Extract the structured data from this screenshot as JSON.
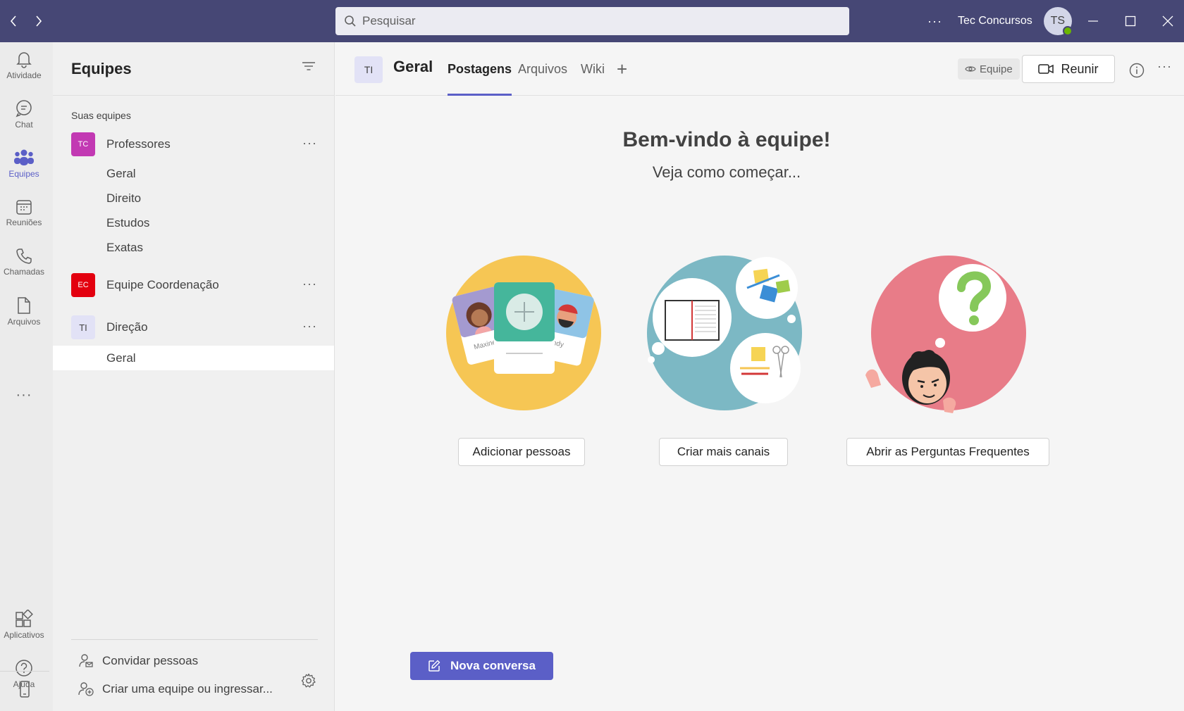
{
  "titlebar": {
    "search_placeholder": "Pesquisar",
    "user_name": "Tec Concursos",
    "avatar_initials": "TS",
    "more_label": "···"
  },
  "rail": {
    "items": [
      {
        "label": "Atividade",
        "icon": "bell-icon"
      },
      {
        "label": "Chat",
        "icon": "chat-icon"
      },
      {
        "label": "Equipes",
        "icon": "teams-icon"
      },
      {
        "label": "Reuniões",
        "icon": "calendar-icon"
      },
      {
        "label": "Chamadas",
        "icon": "phone-icon"
      },
      {
        "label": "Arquivos",
        "icon": "file-icon"
      }
    ],
    "more_label": "···",
    "bottom_items": [
      {
        "label": "Aplicativos",
        "icon": "apps-icon"
      },
      {
        "label": "Ajuda",
        "icon": "help-icon"
      }
    ]
  },
  "panel": {
    "title": "Equipes",
    "section_label": "Suas equipes",
    "teams": [
      {
        "badge": "TC",
        "name": "Professores",
        "color": "#c239b3",
        "channels": [
          "Geral",
          "Direito",
          "Estudos",
          "Exatas"
        ]
      },
      {
        "badge": "EC",
        "name": "Equipe Coordenação",
        "color": "#e3000f",
        "channels": []
      },
      {
        "badge": "TI",
        "name": "Direção",
        "color": "#e2e2f6",
        "channels": [
          "Geral"
        ]
      }
    ],
    "more_label": "···",
    "footer": {
      "invite": "Convidar pessoas",
      "create": "Criar uma equipe ou ingressar..."
    }
  },
  "channel": {
    "badge": "TI",
    "title": "Geral",
    "tabs": [
      "Postagens",
      "Arquivos",
      "Wiki"
    ],
    "add_tab": "+",
    "team_pill": "Equipe",
    "meet_label": "Reunir",
    "more_label": "···"
  },
  "welcome": {
    "title": "Bem-vindo à equipe!",
    "subtitle": "Veja como começar...",
    "actions": [
      "Adicionar pessoas",
      "Criar mais canais",
      "Abrir as Perguntas Frequentes"
    ],
    "card_names": [
      "Maxine",
      "Andy"
    ]
  },
  "compose": {
    "new_conversation": "Nova conversa"
  },
  "colors": {
    "titlebar": "#464775",
    "accent": "#5b5fc7",
    "presence": "#6bb700"
  }
}
